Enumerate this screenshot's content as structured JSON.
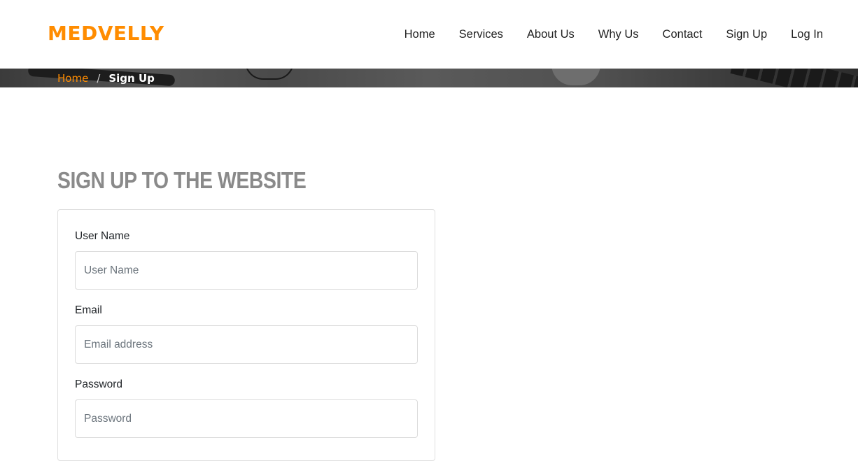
{
  "colors": {
    "brand": "#ff8c00",
    "title": "#8a8a8a",
    "nav_text": "#222222"
  },
  "header": {
    "logo": "MEDVELLY",
    "nav": [
      {
        "label": "Home"
      },
      {
        "label": "Services"
      },
      {
        "label": "About Us"
      },
      {
        "label": "Why Us"
      },
      {
        "label": "Contact"
      },
      {
        "label": "Sign Up"
      },
      {
        "label": "Log In"
      }
    ]
  },
  "breadcrumb": {
    "home": "Home",
    "separator": "/",
    "current": "Sign Up"
  },
  "main": {
    "title": "SIGN UP TO THE WEBSITE",
    "form": {
      "fields": [
        {
          "label": "User Name",
          "placeholder": "User Name",
          "value": ""
        },
        {
          "label": "Email",
          "placeholder": "Email address",
          "value": ""
        },
        {
          "label": "Password",
          "placeholder": "Password",
          "value": ""
        }
      ]
    }
  }
}
